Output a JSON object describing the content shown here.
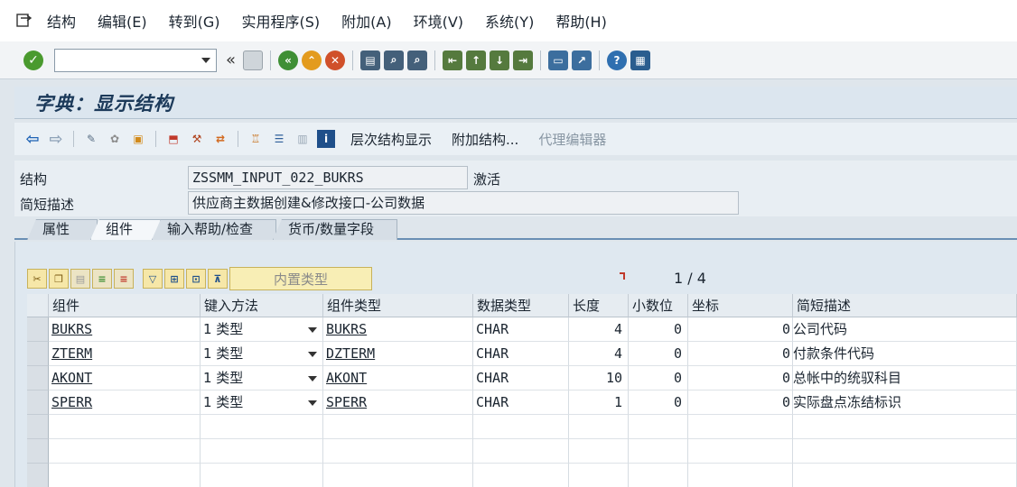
{
  "menubar": {
    "items": [
      "结构",
      "编辑(E)",
      "转到(G)",
      "实用程序(S)",
      "附加(A)",
      "环境(V)",
      "系统(Y)",
      "帮助(H)"
    ]
  },
  "toolbar": {
    "command_value": "",
    "back_chevron": "«"
  },
  "title": "字典：显示结构",
  "app_toolbar": {
    "hierarchy_label": "层次结构显示",
    "append_label": "附加结构...",
    "proxy_label": "代理编辑器"
  },
  "form": {
    "structure_label": "结构",
    "structure_value": "ZSSMM_INPUT_022_BUKRS",
    "status": "激活",
    "desc_label": "简短描述",
    "desc_value": "供应商主数据创建&修改接口-公司数据"
  },
  "tabs": [
    {
      "label": "属性",
      "active": false
    },
    {
      "label": "组件",
      "active": true
    },
    {
      "label": "输入帮助/检查",
      "active": false
    },
    {
      "label": "货币/数量字段",
      "active": false
    }
  ],
  "grid_toolbar": {
    "builtin_label": "内置类型",
    "pager": "1 / 4"
  },
  "table": {
    "columns": [
      "组件",
      "键入方法",
      "组件类型",
      "数据类型",
      "长度",
      "小数位",
      "坐标",
      "简短描述"
    ],
    "rows": [
      {
        "component": "BUKRS",
        "method": "1 类型",
        "type": "BUKRS",
        "dtype": "CHAR",
        "length": "4",
        "decimals": "0",
        "coord": "0",
        "desc": "公司代码"
      },
      {
        "component": "ZTERM",
        "method": "1 类型",
        "type": "DZTERM",
        "dtype": "CHAR",
        "length": "4",
        "decimals": "0",
        "coord": "0",
        "desc": "付款条件代码"
      },
      {
        "component": "AKONT",
        "method": "1 类型",
        "type": "AKONT",
        "dtype": "CHAR",
        "length": "10",
        "decimals": "0",
        "coord": "0",
        "desc": "总帐中的统驭科目"
      },
      {
        "component": "SPERR",
        "method": "1 类型",
        "type": "SPERR",
        "dtype": "CHAR",
        "length": "1",
        "decimals": "0",
        "coord": "0",
        "desc": "实际盘点冻结标识"
      }
    ]
  },
  "colors": {
    "ok_green": "#4a9a2e",
    "title_text": "#1c3a5a",
    "tab_underline": "#6a8fb4",
    "builtin_bg": "#f8eeb5"
  }
}
